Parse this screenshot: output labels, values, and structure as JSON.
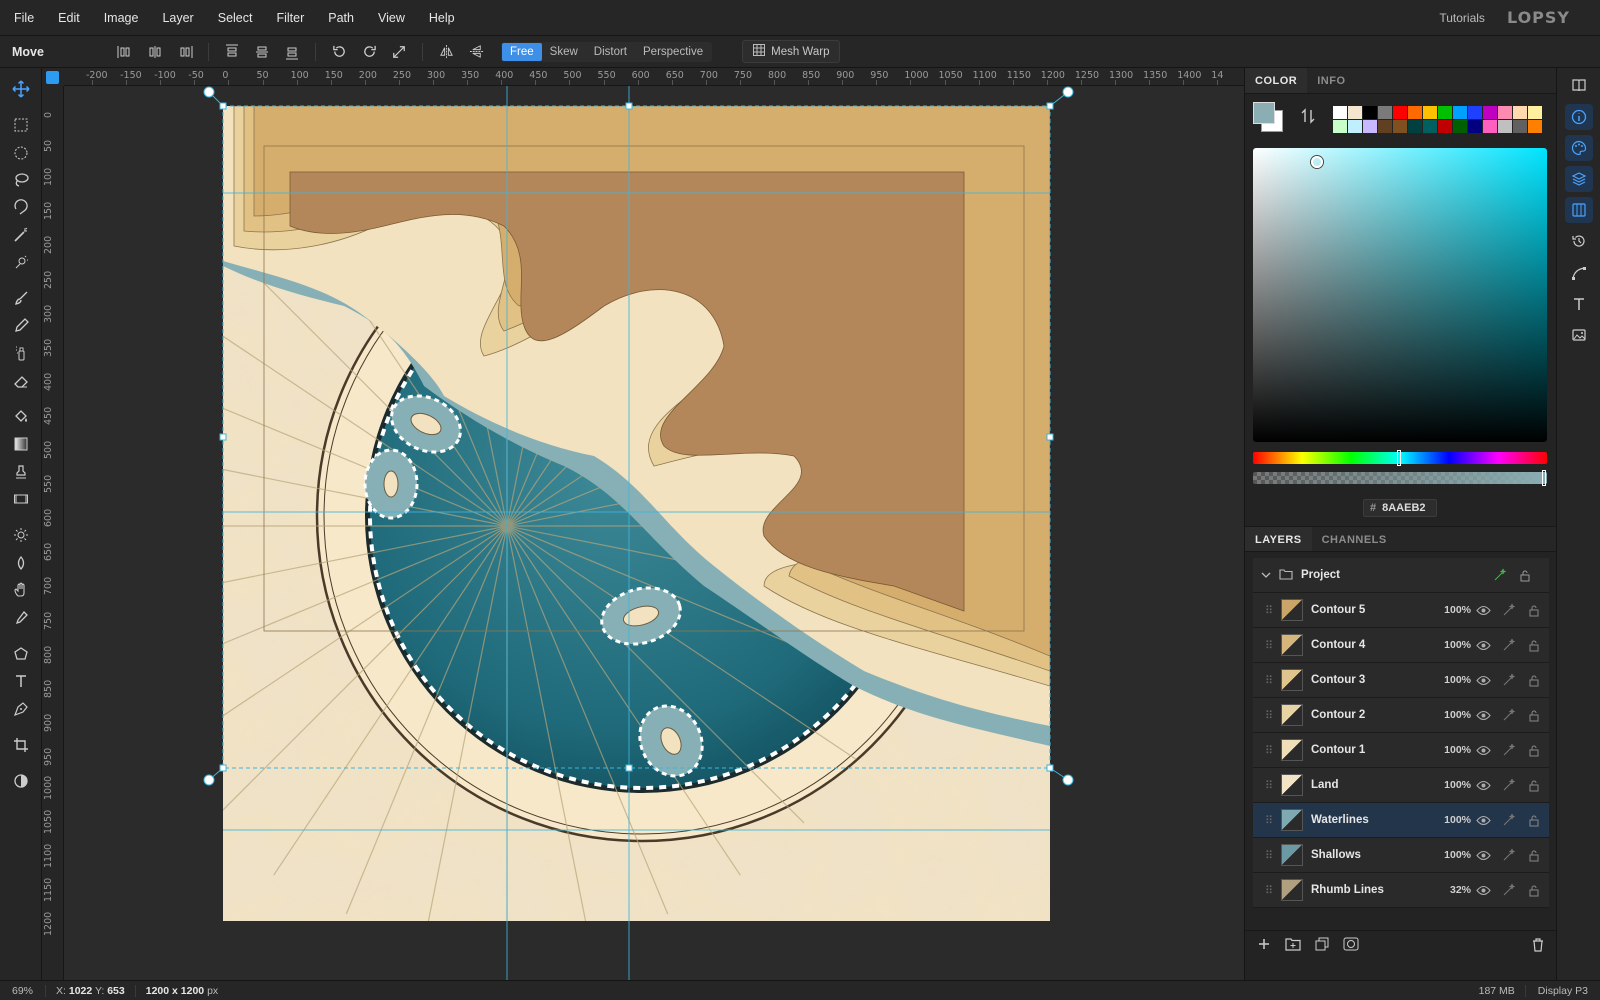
{
  "menu": [
    "File",
    "Edit",
    "Image",
    "Layer",
    "Select",
    "Filter",
    "Path",
    "View",
    "Help"
  ],
  "header": {
    "tutorials": "Tutorials",
    "logo": "LOPSY"
  },
  "options": {
    "tool_name": "Move",
    "transform_modes": [
      "Free",
      "Skew",
      "Distort",
      "Perspective"
    ],
    "active_mode": "Free",
    "mesh_warp": "Mesh Warp"
  },
  "ruler": {
    "top_labels": [
      "-200",
      "-150",
      "-100",
      "-50",
      "0",
      "50",
      "100",
      "150",
      "200",
      "250",
      "300",
      "350",
      "400",
      "450",
      "500",
      "550",
      "600",
      "650",
      "700",
      "750",
      "800",
      "850",
      "900",
      "950",
      "1000",
      "1050",
      "1100",
      "1150",
      "1200",
      "1250",
      "1300",
      "1350",
      "1400",
      "14"
    ],
    "left_labels": [
      "0",
      "50",
      "100",
      "150",
      "200",
      "250",
      "300",
      "350",
      "400",
      "450",
      "500",
      "550",
      "600",
      "650",
      "700",
      "750",
      "800",
      "850",
      "900",
      "950",
      "1000",
      "1050",
      "1100",
      "1150",
      "1200"
    ]
  },
  "color_panel": {
    "tabs": [
      "COLOR",
      "INFO"
    ],
    "hex": "8AAEB2",
    "fg_color": "#8aaeb2",
    "swatches": [
      "#ffffff",
      "#f5e6d0",
      "#000000",
      "#7a7a7a",
      "#ff0000",
      "#ff6a00",
      "#ffc000",
      "#00c000",
      "#00a0ff",
      "#2040ff",
      "#c000c0",
      "#ff8ab0",
      "#ffd8b0",
      "#fff0a0",
      "#c8ffc8",
      "#c0f0ff",
      "#c8b8ff",
      "#604020",
      "#805020",
      "#004040",
      "#006060",
      "#c00000",
      "#006000",
      "#000080",
      "#ff60c0",
      "#c0c0c0",
      "#606060",
      "#ff8000"
    ]
  },
  "layers_panel": {
    "tabs": [
      "LAYERS",
      "CHANNELS"
    ],
    "group": "Project",
    "layers": [
      {
        "name": "Contour 5",
        "opacity": "100%",
        "thumb": "#c9a56a"
      },
      {
        "name": "Contour 4",
        "opacity": "100%",
        "thumb": "#d6b57c"
      },
      {
        "name": "Contour 3",
        "opacity": "100%",
        "thumb": "#e0c48e"
      },
      {
        "name": "Contour 2",
        "opacity": "100%",
        "thumb": "#e8d3a2"
      },
      {
        "name": "Contour 1",
        "opacity": "100%",
        "thumb": "#efdfb8"
      },
      {
        "name": "Land",
        "opacity": "100%",
        "thumb": "#f2e4c4"
      },
      {
        "name": "Waterlines",
        "opacity": "100%",
        "thumb": "#7fa9b0"
      },
      {
        "name": "Shallows",
        "opacity": "100%",
        "thumb": "#6c9aa4"
      },
      {
        "name": "Rhumb Lines",
        "opacity": "32%",
        "thumb": "#b0a080"
      }
    ],
    "selected": "Waterlines"
  },
  "status": {
    "zoom": "69%",
    "x_label": "X:",
    "x": "1022",
    "y_label": "Y:",
    "y": "653",
    "dims": "1200 x 1200",
    "dims_unit": "px",
    "memory": "187 MB",
    "profile": "Display P3"
  }
}
